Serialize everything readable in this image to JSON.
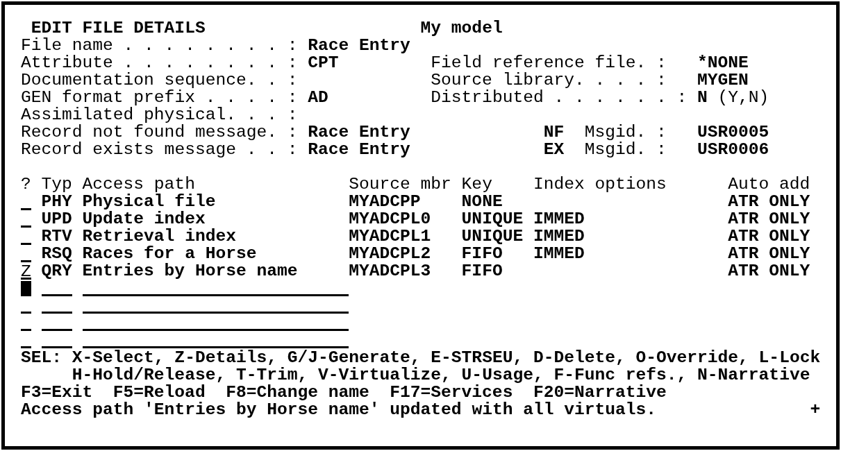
{
  "header": {
    "title": "EDIT FILE DETAILS",
    "model": "My model"
  },
  "details": [
    {
      "label": "File name . . . . . . . . :",
      "value": "Race Entry"
    },
    {
      "label": "Attribute . . . . . . . . :",
      "value": "CPT",
      "right": {
        "label": "Field reference file. :",
        "value": "*NONE"
      }
    },
    {
      "label": "Documentation sequence. . :",
      "right": {
        "label": "Source library. . . . :",
        "value": "MYGEN"
      }
    },
    {
      "label": "GEN format prefix . . . . :",
      "value": "AD",
      "right": {
        "label": "Distributed . . . . . . :",
        "value": "N",
        "hint": "(Y,N)"
      }
    },
    {
      "label": "Assimilated physical. . . :"
    },
    {
      "label": "Record not found message. :",
      "value": "Race Entry",
      "right": {
        "code": "NF",
        "label": "Msgid. :",
        "value": "USR0005"
      }
    },
    {
      "label": "Record exists message . . :",
      "value": "Race Entry",
      "right": {
        "code": "EX",
        "label": "Msgid. :",
        "value": "USR0006"
      }
    }
  ],
  "table": {
    "columns": [
      "?",
      "Typ",
      "Access path",
      "Source mbr",
      "Key",
      "Index options",
      "Auto add"
    ],
    "rows": [
      {
        "type": "PHY",
        "access_path": "Physical file",
        "source_mbr": "MYADCPP",
        "key": "NONE",
        "auto_add": "ATR ONLY"
      },
      {
        "type": "UPD",
        "access_path": "Update index",
        "source_mbr": "MYADCPL0",
        "key": "UNIQUE",
        "index_options": "IMMED",
        "auto_add": "ATR ONLY"
      },
      {
        "type": "RTV",
        "access_path": "Retrieval index",
        "source_mbr": "MYADCPL1",
        "key": "UNIQUE",
        "index_options": "IMMED",
        "auto_add": "ATR ONLY"
      },
      {
        "type": "RSQ",
        "access_path": "Races for a Horse",
        "source_mbr": "MYADCPL2",
        "key": "FIFO",
        "index_options": "IMMED",
        "auto_add": "ATR ONLY"
      },
      {
        "option": "Z",
        "type": "QRY",
        "access_path": "Entries by Horse name",
        "source_mbr": "MYADCPL3",
        "key": "FIFO",
        "auto_add": "ATR ONLY"
      }
    ],
    "entry_rows": [
      {
        "cursor": true
      },
      {
        "cursor": false
      },
      {
        "cursor": false
      },
      {
        "cursor": false
      }
    ]
  },
  "legend": {
    "label": "SEL:",
    "lines": [
      "X-Select, Z-Details, G/J-Generate, E-STRSEU, D-Delete, O-Override, L-Lock",
      "H-Hold/Release, T-Trim, V-Virtualize, U-Usage, F-Func refs., N-Narrative"
    ]
  },
  "function_keys": [
    "F3=Exit",
    "F5=Reload",
    "F8=Change name",
    "F17=Services",
    "F20=Narrative"
  ],
  "message": {
    "text": "Access path 'Entries by Horse name' updated with all virtuals.",
    "more": "+"
  }
}
